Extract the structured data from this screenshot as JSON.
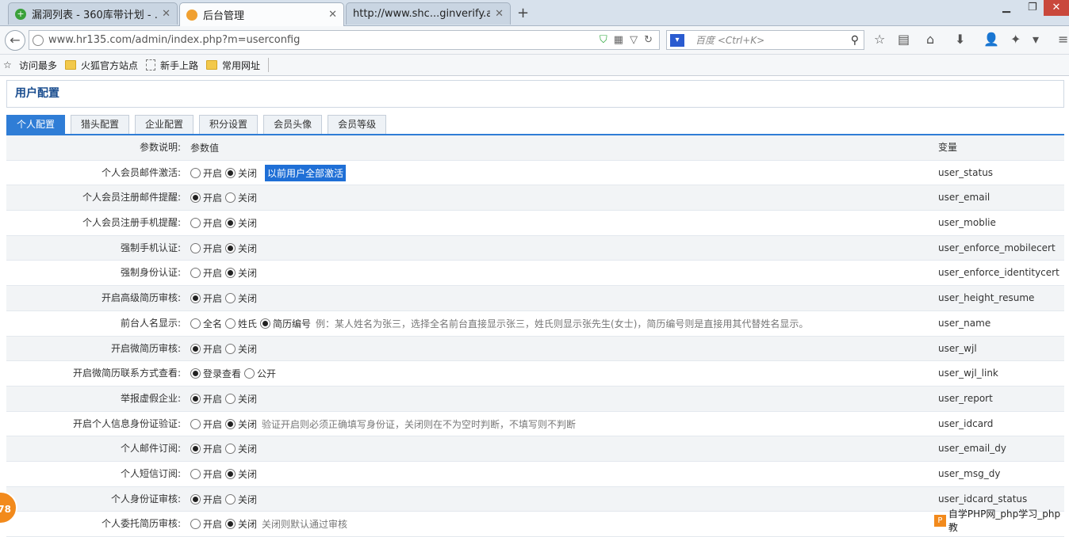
{
  "browser": {
    "tabs": [
      {
        "title": "漏洞列表 - 360库带计划 - ..."
      },
      {
        "title": "后台管理"
      },
      {
        "title": "http://www.shc...ginverify.asp"
      }
    ],
    "url": "www.hr135.com/admin/index.php?m=userconfig",
    "search_placeholder": "百度 <Ctrl+K>",
    "bookmarks": [
      "访问最多",
      "火狐官方站点",
      "新手上路",
      "常用网址"
    ]
  },
  "page": {
    "title": "用户配置",
    "tabs": [
      "个人配置",
      "猎头配置",
      "企业配置",
      "积分设置",
      "会员头像",
      "会员等级"
    ],
    "active_tab": "个人配置",
    "header": {
      "label": "参数说明:",
      "value": "参数值",
      "var": "变量"
    }
  },
  "rows": [
    {
      "label": "个人会员邮件激活:",
      "options": [
        "开启",
        "关闭"
      ],
      "selected": 1,
      "action": "以前用户全部激活",
      "var": "user_status"
    },
    {
      "label": "个人会员注册邮件提醒:",
      "options": [
        "开启",
        "关闭"
      ],
      "selected": 0,
      "var": "user_email"
    },
    {
      "label": "个人会员注册手机提醒:",
      "options": [
        "开启",
        "关闭"
      ],
      "selected": 1,
      "var": "user_moblie"
    },
    {
      "label": "强制手机认证:",
      "options": [
        "开启",
        "关闭"
      ],
      "selected": 1,
      "var": "user_enforce_mobilecert"
    },
    {
      "label": "强制身份认证:",
      "options": [
        "开启",
        "关闭"
      ],
      "selected": 1,
      "var": "user_enforce_identitycert"
    },
    {
      "label": "开启高级简历审核:",
      "options": [
        "开启",
        "关闭"
      ],
      "selected": 0,
      "var": "user_height_resume"
    },
    {
      "label": "前台人名显示:",
      "options": [
        "全名",
        "姓氏",
        "简历编号"
      ],
      "selected": 2,
      "hint": "例：某人姓名为张三，选择全名前台直接显示张三，姓氏则显示张先生(女士)，简历编号则是直接用其代替姓名显示。",
      "var": "user_name"
    },
    {
      "label": "开启微简历审核:",
      "options": [
        "开启",
        "关闭"
      ],
      "selected": 0,
      "var": "user_wjl"
    },
    {
      "label": "开启微简历联系方式查看:",
      "options": [
        "登录查看",
        "公开"
      ],
      "selected": 0,
      "var": "user_wjl_link"
    },
    {
      "label": "举报虚假企业:",
      "options": [
        "开启",
        "关闭"
      ],
      "selected": 0,
      "var": "user_report"
    },
    {
      "label": "开启个人信息身份证验证:",
      "options": [
        "开启",
        "关闭"
      ],
      "selected": 1,
      "hint": "验证开启则必须正确填写身份证，关闭则在不为空时判断，不填写则不判断",
      "var": "user_idcard"
    },
    {
      "label": "个人邮件订阅:",
      "options": [
        "开启",
        "关闭"
      ],
      "selected": 0,
      "var": "user_email_dy"
    },
    {
      "label": "个人短信订阅:",
      "options": [
        "开启",
        "关闭"
      ],
      "selected": 1,
      "var": "user_msg_dy"
    },
    {
      "label": "个人身份证审核:",
      "options": [
        "开启",
        "关闭"
      ],
      "selected": 0,
      "var": "user_idcard_status"
    },
    {
      "label": "个人委托简历审核:",
      "options": [
        "开启",
        "关闭"
      ],
      "selected": 1,
      "hint": "关闭则默认通过审核",
      "var": ""
    }
  ],
  "overlay": {
    "badge": "78",
    "watermark": "自学PHP网_php学习_php教"
  }
}
